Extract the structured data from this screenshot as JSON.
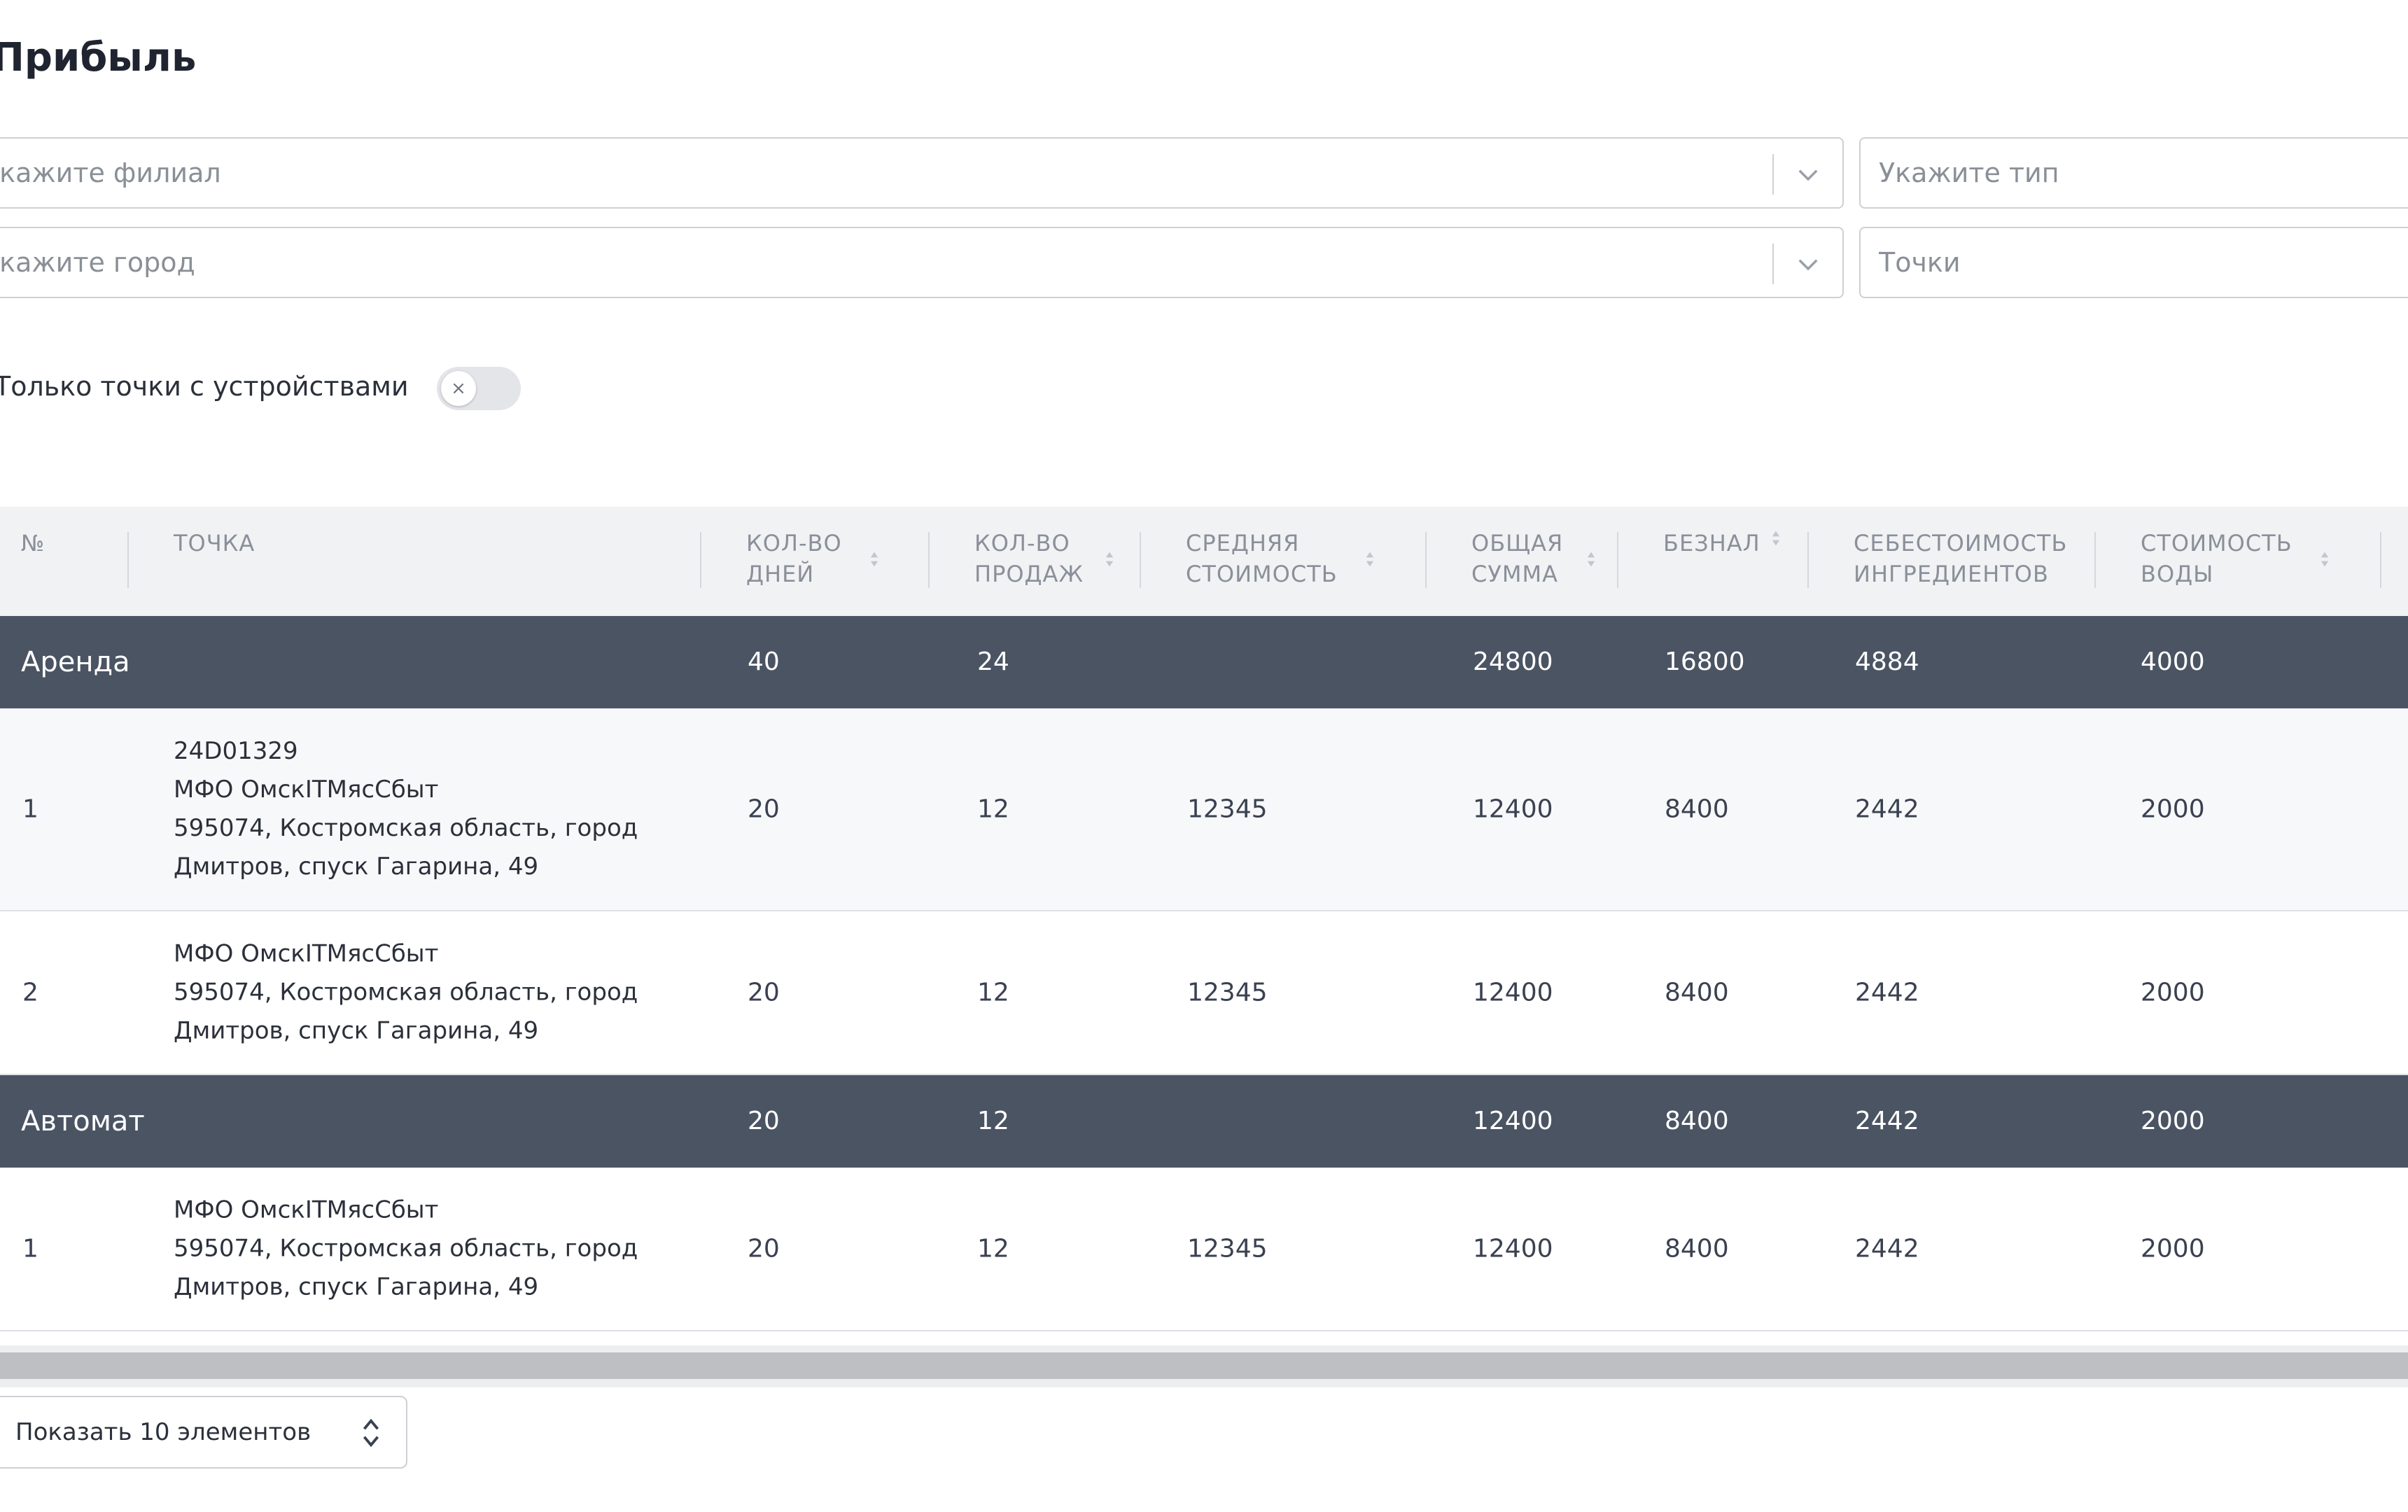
{
  "title": "Прибыль",
  "filters": {
    "branch_placeholder": "Укажите филиал",
    "city_placeholder": "Укажите город",
    "type_placeholder": "Укажите тип",
    "points_placeholder": "Точки"
  },
  "toggle": {
    "label": "Только точки с устройствами",
    "checked": false,
    "knob_glyph": "×"
  },
  "table": {
    "headers": {
      "num": "№",
      "point": "Точка",
      "days": [
        "Кол-во",
        "дней"
      ],
      "sales": [
        "Кол-во",
        "продаж"
      ],
      "avg": [
        "Средняя",
        "стоимость"
      ],
      "total": [
        "Общая",
        "сумма"
      ],
      "cashless": "Безнал",
      "ingredients": [
        "Себестоимость",
        "ингредиентов"
      ],
      "water": [
        "Стоимость",
        "воды"
      ]
    },
    "groups": [
      {
        "name": "Аренда",
        "days": "40",
        "sales": "24",
        "avg": "",
        "total": "24800",
        "cashless": "16800",
        "ingredients": "4884",
        "water": "4000",
        "rows": [
          {
            "num": "1",
            "lines": [
              "24D01329",
              "МФО ОмскITМясСбыт",
              "595074, Костромская область, город",
              "Дмитров, спуск Гагарина, 49"
            ],
            "days": "20",
            "sales": "12",
            "avg": "12345",
            "total": "12400",
            "cashless": "8400",
            "ingredients": "2442",
            "water": "2000"
          },
          {
            "num": "2",
            "lines": [
              "МФО ОмскITМясСбыт",
              "595074, Костромская область, город",
              "Дмитров, спуск Гагарина, 49"
            ],
            "days": "20",
            "sales": "12",
            "avg": "12345",
            "total": "12400",
            "cashless": "8400",
            "ingredients": "2442",
            "water": "2000"
          }
        ]
      },
      {
        "name": "Автомат",
        "days": "20",
        "sales": "12",
        "avg": "",
        "total": "12400",
        "cashless": "8400",
        "ingredients": "2442",
        "water": "2000",
        "rows": [
          {
            "num": "1",
            "lines": [
              "МФО ОмскITМясСбыт",
              "595074, Костромская область, город",
              "Дмитров, спуск Гагарина, 49"
            ],
            "days": "20",
            "sales": "12",
            "avg": "12345",
            "total": "12400",
            "cashless": "8400",
            "ingredients": "2442",
            "water": "2000"
          }
        ]
      }
    ]
  },
  "pagination": {
    "page_size_label": "Показать 10 элементов"
  },
  "colors": {
    "group_row_bg": "#4b5463",
    "header_bg": "#f1f2f4",
    "border": "#cdd0d5"
  }
}
